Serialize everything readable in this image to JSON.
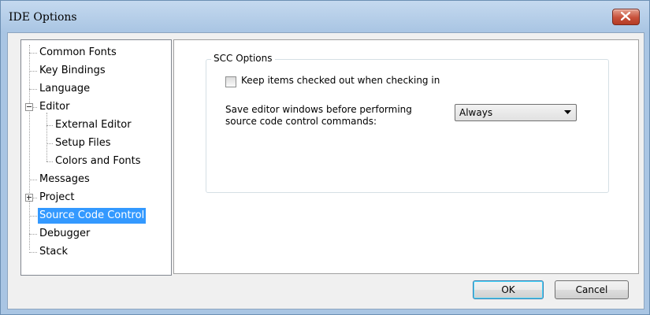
{
  "window": {
    "title": "IDE Options"
  },
  "tree": {
    "items": [
      {
        "label": "Common Fonts"
      },
      {
        "label": "Key Bindings"
      },
      {
        "label": "Language"
      },
      {
        "label": "Editor",
        "expanded": true
      },
      {
        "label": "External Editor"
      },
      {
        "label": "Setup Files"
      },
      {
        "label": "Colors and Fonts"
      },
      {
        "label": "Messages"
      },
      {
        "label": "Project",
        "expanded": false
      },
      {
        "label": "Source Code Control",
        "selected": true
      },
      {
        "label": "Debugger"
      },
      {
        "label": "Stack"
      }
    ]
  },
  "scc_options": {
    "group_title": "SCC Options",
    "keep_checked_out_label": "Keep items checked out when checking in",
    "keep_checked_out_checked": false,
    "save_editor_label_line1": "Save editor windows before performing",
    "save_editor_label_line2": "source code control commands:",
    "save_editor_selected": "Always"
  },
  "buttons": {
    "ok": "OK",
    "cancel": "Cancel"
  },
  "colors": {
    "selection": "#3399ff",
    "close_button": "#c7503a",
    "title_bar": "#a9c5e3"
  }
}
